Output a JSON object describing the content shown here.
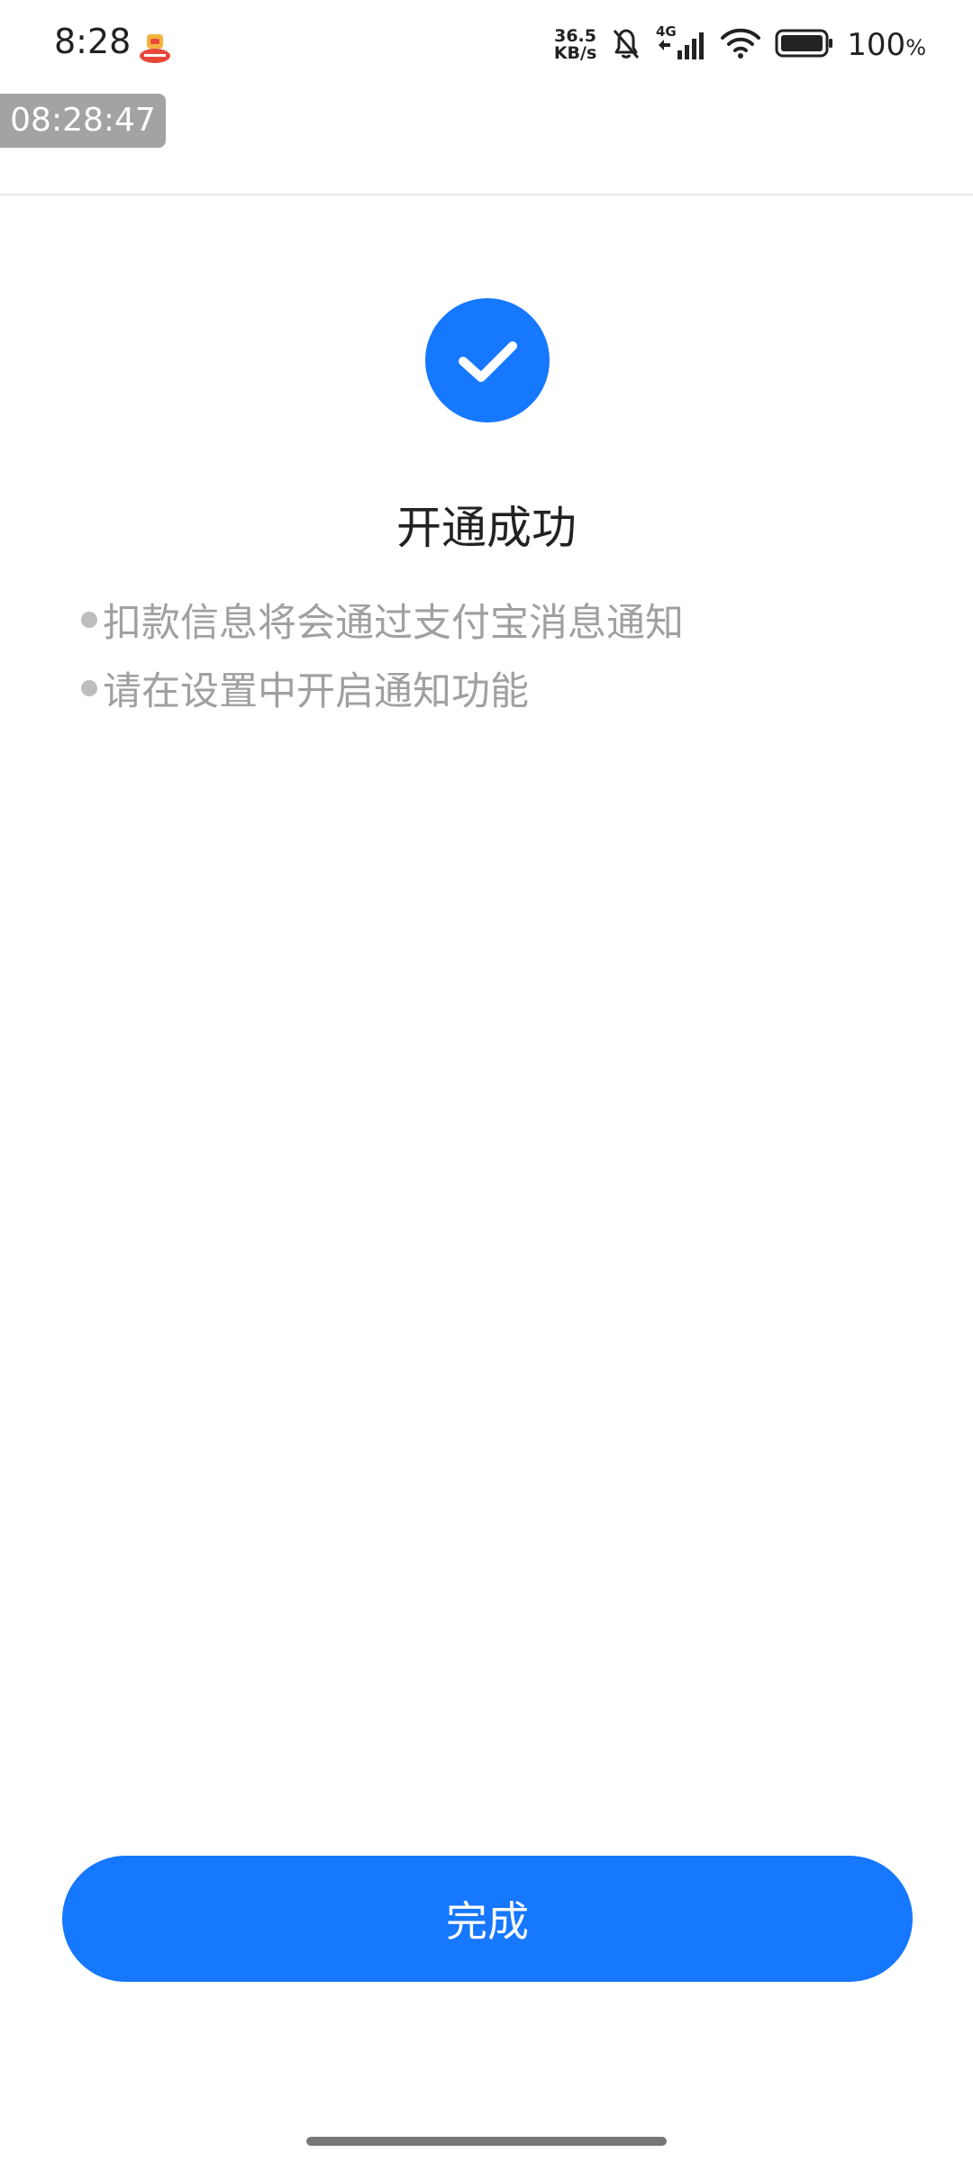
{
  "status_bar": {
    "time": "8:28",
    "app_icon": "jd-shop-icon",
    "speed_value": "36.5",
    "speed_unit": "KB/s",
    "network": "4G",
    "battery_level": "100",
    "battery_unit": "%",
    "icons": [
      "mute-bell-icon",
      "signal-icon",
      "wifi-icon",
      "battery-icon"
    ]
  },
  "overlay": {
    "timestamp": "08:28:47"
  },
  "result": {
    "icon": "check-circle-icon",
    "title": "开通成功",
    "tips": [
      "扣款信息将会通过支付宝消息通知",
      "请在设置中开启通知功能"
    ]
  },
  "footer": {
    "done_label": "完成"
  },
  "colors": {
    "accent": "#1677ff",
    "tip_text": "#a0a0a0",
    "title_text": "#222222"
  }
}
